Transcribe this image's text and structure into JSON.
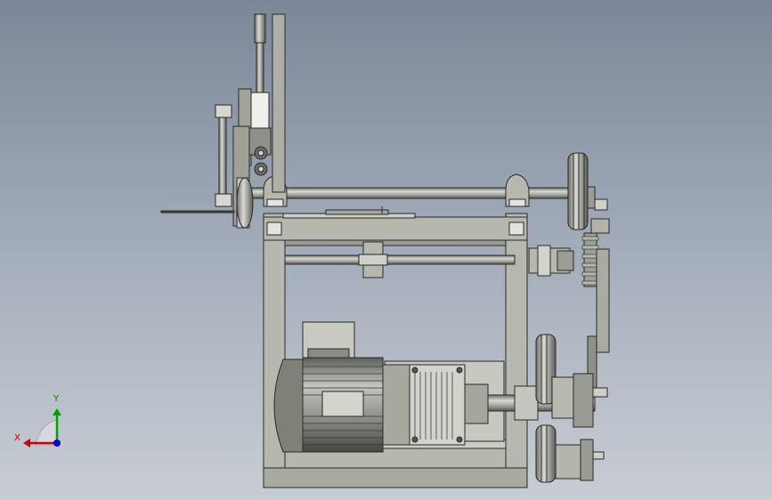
{
  "triad": {
    "x_label": "X",
    "y_label": "Y"
  },
  "colors": {
    "steel": "#b6b8ad",
    "steel_dark": "#7d7f76",
    "steel_light": "#d6d7cf",
    "edge": "#2a2a28",
    "motor_body": "#8e918a",
    "axis_x": "#d00000",
    "axis_y": "#00a000",
    "axis_z": "#0000d0"
  }
}
